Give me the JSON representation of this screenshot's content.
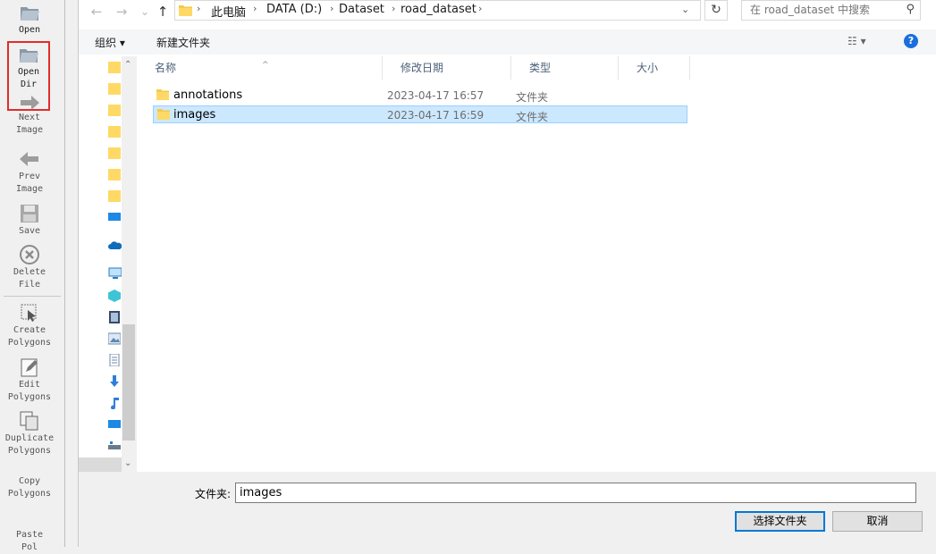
{
  "toolbar": {
    "open": "Open",
    "open_dir": [
      "Open",
      "Dir"
    ],
    "next_image": [
      "Next",
      "Image"
    ],
    "prev_image": [
      "Prev",
      "Image"
    ],
    "save": "Save",
    "delete_file": [
      "Delete",
      "File"
    ],
    "create_polygons": [
      "Create",
      "Polygons"
    ],
    "edit_polygons": [
      "Edit",
      "Polygons"
    ],
    "duplicate_polygons": [
      "Duplicate",
      "Polygons"
    ],
    "copy_polygons": [
      "Copy",
      "Polygons"
    ],
    "paste_polygons": [
      "Paste",
      "Pol"
    ]
  },
  "address": {
    "segments": [
      "此电脑",
      "DATA (D:)",
      "Dataset",
      "road_dataset"
    ]
  },
  "search": {
    "placeholder": "在 road_dataset 中搜索"
  },
  "commands": {
    "organize": "组织 ▾",
    "new_folder": "新建文件夹"
  },
  "columns": {
    "name": "名称",
    "modified": "修改日期",
    "type": "类型",
    "size": "大小"
  },
  "files": [
    {
      "name": "annotations",
      "modified": "2023-04-17 16:57",
      "type": "文件夹",
      "selected": false
    },
    {
      "name": "images",
      "modified": "2023-04-17 16:59",
      "type": "文件夹",
      "selected": true
    }
  ],
  "footer": {
    "folder_label": "文件夹:",
    "folder_value": "images",
    "select_button": "选择文件夹",
    "cancel_button": "取消"
  },
  "colors": {
    "accent": "#0078d7",
    "selection": "#cce8ff",
    "highlight_box": "#e32b2b",
    "folder": "#f5c94a"
  }
}
